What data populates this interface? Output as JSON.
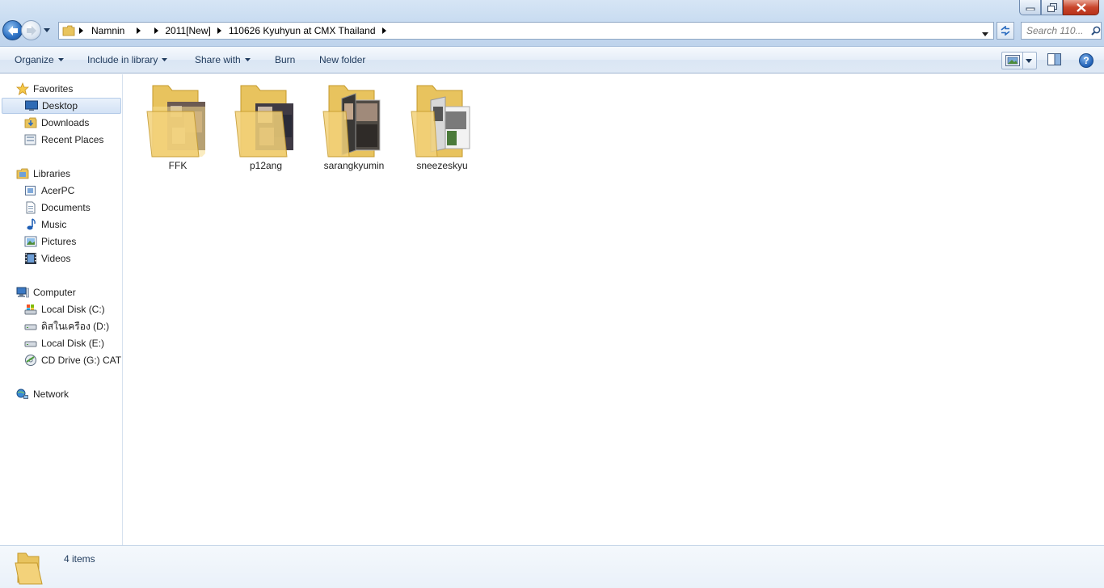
{
  "window": {
    "minimize_icon": "minimize-icon",
    "maximize_icon": "restore-icon",
    "close_icon": "close-icon"
  },
  "address": {
    "breadcrumbs": [
      "Namnin",
      "2011[New]",
      "110626 Kyuhyun at CMX Thailand"
    ],
    "search_placeholder": "Search 110..."
  },
  "toolbar": {
    "organize": "Organize",
    "include_in_library": "Include in library",
    "share_with": "Share with",
    "burn": "Burn",
    "new_folder": "New folder",
    "help": "?"
  },
  "sidebar": {
    "favorites": {
      "label": "Favorites",
      "items": [
        "Desktop",
        "Downloads",
        "Recent Places"
      ],
      "selected": "Desktop"
    },
    "libraries": {
      "label": "Libraries",
      "items": [
        "AcerPC",
        "Documents",
        "Music",
        "Pictures",
        "Videos"
      ]
    },
    "computer": {
      "label": "Computer",
      "items": [
        "Local Disk (C:)",
        "ดิสในเครือง (D:)",
        "Local Disk (E:)",
        "CD Drive (G:) CAT C"
      ]
    },
    "network": {
      "label": "Network"
    }
  },
  "files": [
    {
      "name": "FFK"
    },
    {
      "name": "p12ang"
    },
    {
      "name": "sarangkyumin"
    },
    {
      "name": "sneezeskyu"
    }
  ],
  "details": {
    "item_count": "4 items"
  },
  "colors": {
    "accent": "#1e395b",
    "folder": "#f3d27a",
    "selection": "#d3e2f5"
  }
}
